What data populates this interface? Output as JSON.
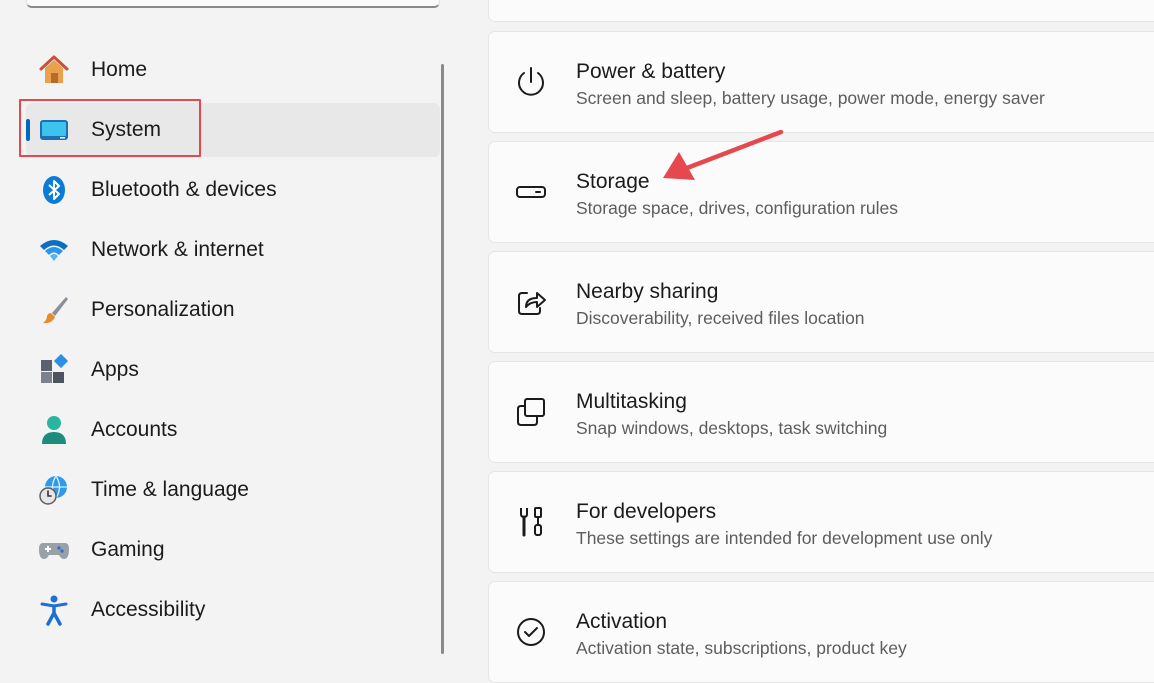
{
  "sidebar": {
    "items": [
      {
        "label": "Home",
        "icon": "home-icon"
      },
      {
        "label": "System",
        "icon": "system-icon",
        "active": true
      },
      {
        "label": "Bluetooth & devices",
        "icon": "bluetooth-icon"
      },
      {
        "label": "Network & internet",
        "icon": "wifi-icon"
      },
      {
        "label": "Personalization",
        "icon": "paintbrush-icon"
      },
      {
        "label": "Apps",
        "icon": "apps-icon"
      },
      {
        "label": "Accounts",
        "icon": "person-icon"
      },
      {
        "label": "Time & language",
        "icon": "globe-clock-icon"
      },
      {
        "label": "Gaming",
        "icon": "gamepad-icon"
      },
      {
        "label": "Accessibility",
        "icon": "accessibility-icon"
      }
    ]
  },
  "main": {
    "cards": [
      {
        "title": "Power & battery",
        "description": "Screen and sleep, battery usage, power mode, energy saver",
        "icon": "power-icon"
      },
      {
        "title": "Storage",
        "description": "Storage space, drives, configuration rules",
        "icon": "storage-drive-icon"
      },
      {
        "title": "Nearby sharing",
        "description": "Discoverability, received files location",
        "icon": "share-icon"
      },
      {
        "title": "Multitasking",
        "description": "Snap windows, desktops, task switching",
        "icon": "multitasking-icon"
      },
      {
        "title": "For developers",
        "description": "These settings are intended for development use only",
        "icon": "developer-tools-icon"
      },
      {
        "title": "Activation",
        "description": "Activation state, subscriptions, product key",
        "icon": "checkmark-circle-icon"
      }
    ]
  },
  "colors": {
    "accent": "#0067c0",
    "annotation": "#e5484d",
    "background": "#f3f3f3",
    "card": "#fbfbfb"
  }
}
